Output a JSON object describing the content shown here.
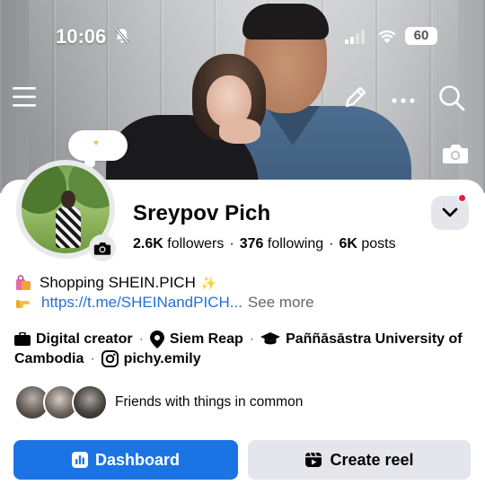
{
  "status_bar": {
    "time": "10:06",
    "battery": "60"
  },
  "profile": {
    "name": "Sreypov Pich",
    "stats": {
      "followers_count": "2.6K",
      "followers_label": "followers",
      "following_count": "376",
      "following_label": "following",
      "posts_count": "6K",
      "posts_label": "posts"
    }
  },
  "bio": {
    "line1": "Shopping SHEIN.PICH",
    "link": "https://t.me/SHEINandPICH...",
    "see_more": "See more"
  },
  "details": {
    "role": "Digital creator",
    "location": "Siem Reap",
    "school_line1": "Paññāsāstra University of",
    "school_line2": "Cambodia",
    "instagram": "pichy.emily"
  },
  "friends": {
    "text": "Friends with things in common"
  },
  "actions": {
    "dashboard": "Dashboard",
    "create_reel": "Create reel"
  },
  "colors": {
    "primary": "#1b74e4",
    "link": "#216fdb",
    "notification": "#e41e3f"
  }
}
